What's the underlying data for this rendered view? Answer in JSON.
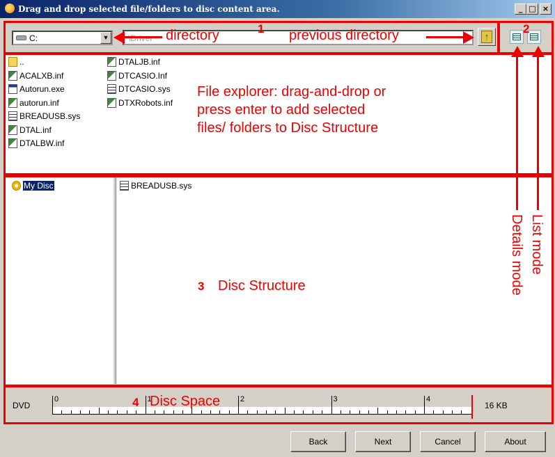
{
  "window": {
    "title": "Drag and drop selected file/folders to disc content area.",
    "controls": [
      "_",
      "□",
      "×"
    ]
  },
  "toolbar": {
    "drive": "C:",
    "path_placeholder": "\\Driver",
    "up_icon": "folder-up-icon"
  },
  "annotations": {
    "n1": "1",
    "n2": "2",
    "n3": "3",
    "n4": "4",
    "directory": "directory",
    "previous_directory": "previous directory",
    "explorer_note_1": "File explorer: drag-and-drop or",
    "explorer_note_2": "press enter to add selected",
    "explorer_note_3": "files/ folders to Disc Structure",
    "disc_structure": "Disc Structure",
    "disc_space": "Disc Space",
    "details_mode": "Details mode",
    "list_mode": "List mode",
    "color": "#e00000"
  },
  "explorer": {
    "col1": [
      {
        "name": "..",
        "type": "folder"
      },
      {
        "name": "ACALXB.inf",
        "type": "inf"
      },
      {
        "name": "Autorun.exe",
        "type": "exe"
      },
      {
        "name": "autorun.inf",
        "type": "inf"
      },
      {
        "name": "BREADUSB.sys",
        "type": "sys"
      },
      {
        "name": "DTAL.inf",
        "type": "inf"
      },
      {
        "name": "DTALBW.inf",
        "type": "inf"
      }
    ],
    "col2": [
      {
        "name": "DTALJB.inf",
        "type": "inf"
      },
      {
        "name": "DTCASIO.Inf",
        "type": "inf"
      },
      {
        "name": "DTCASIO.sys",
        "type": "sys"
      },
      {
        "name": "DTXRobots.inf",
        "type": "inf"
      }
    ]
  },
  "disc": {
    "root": "My Disc",
    "content": [
      {
        "name": "BREADUSB.sys",
        "type": "sys"
      }
    ]
  },
  "space": {
    "media": "DVD",
    "ticks": [
      "0",
      "1",
      "2",
      "3",
      "4"
    ],
    "used": "16 KB"
  },
  "buttons": {
    "back": "Back",
    "next": "Next",
    "cancel": "Cancel",
    "about": "About"
  }
}
